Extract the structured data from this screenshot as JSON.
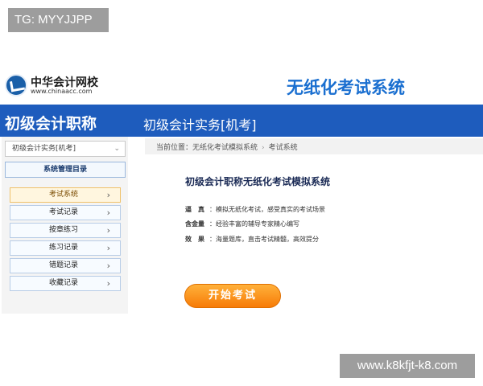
{
  "badge": {
    "text": "TG: MYYJJPP"
  },
  "logo": {
    "name": "中华会计网校",
    "url": "www.chinaacc.com"
  },
  "header": {
    "system_title": "无纸化考试系统"
  },
  "bar": {
    "left_title": "初级会计职称",
    "right_title": "初级会计实务[机考]"
  },
  "sidebar": {
    "select_value": "初级会计实务[机考]",
    "menu_header": "系统管理目录",
    "items": [
      {
        "label": "考试系统",
        "active": true
      },
      {
        "label": "考试记录"
      },
      {
        "label": "按章练习"
      },
      {
        "label": "练习记录"
      },
      {
        "label": "错题记录"
      },
      {
        "label": "收藏记录"
      }
    ]
  },
  "breadcrumb": {
    "prefix": "当前位置：",
    "path": "无纸化考试模拟系统",
    "current": "考试系统"
  },
  "main": {
    "title": "初级会计职称无纸化考试模拟系统",
    "features": [
      {
        "label": "逼　真",
        "text": "：模拟无纸化考试，感受真实的考试场景"
      },
      {
        "label": "含金量",
        "text": "：经验丰富的辅导专家精心编写"
      },
      {
        "label": "效　果",
        "text": "：海量题库，直击考试精髓，高效提分"
      }
    ],
    "start_button": "开始考试"
  },
  "watermark": {
    "text": "www.k8kfjt-k8.com"
  }
}
